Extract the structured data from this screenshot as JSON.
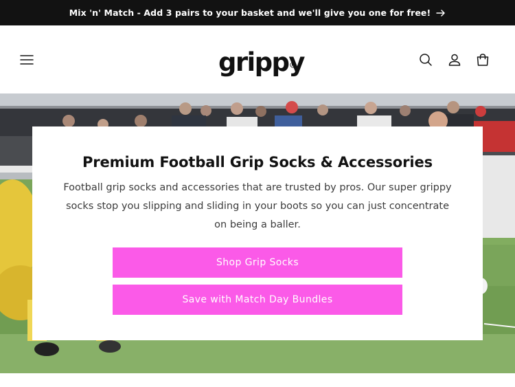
{
  "announcement": {
    "text": "Mix 'n' Match - Add 3 pairs to your basket and we'll give you one for free!",
    "icon": "arrow-right-icon"
  },
  "header": {
    "logo_text": "grippy",
    "menu_icon": "hamburger-menu-icon",
    "search_icon": "search-icon",
    "account_icon": "account-icon",
    "cart_icon": "cart-icon"
  },
  "hero": {
    "title": "Premium Football Grip Socks & Accessories",
    "text": "Football grip socks and accessories that are trusted by pros. Our super grippy socks stop you slipping and sliding in your boots so you can just concentrate on being a baller.",
    "buttons": {
      "primary": "Shop Grip Socks",
      "secondary": "Save with Match Day Bundles"
    }
  },
  "colors": {
    "announcement_bg": "#121212",
    "button_bg": "#fb5ae8",
    "button_text": "#ffffff"
  }
}
